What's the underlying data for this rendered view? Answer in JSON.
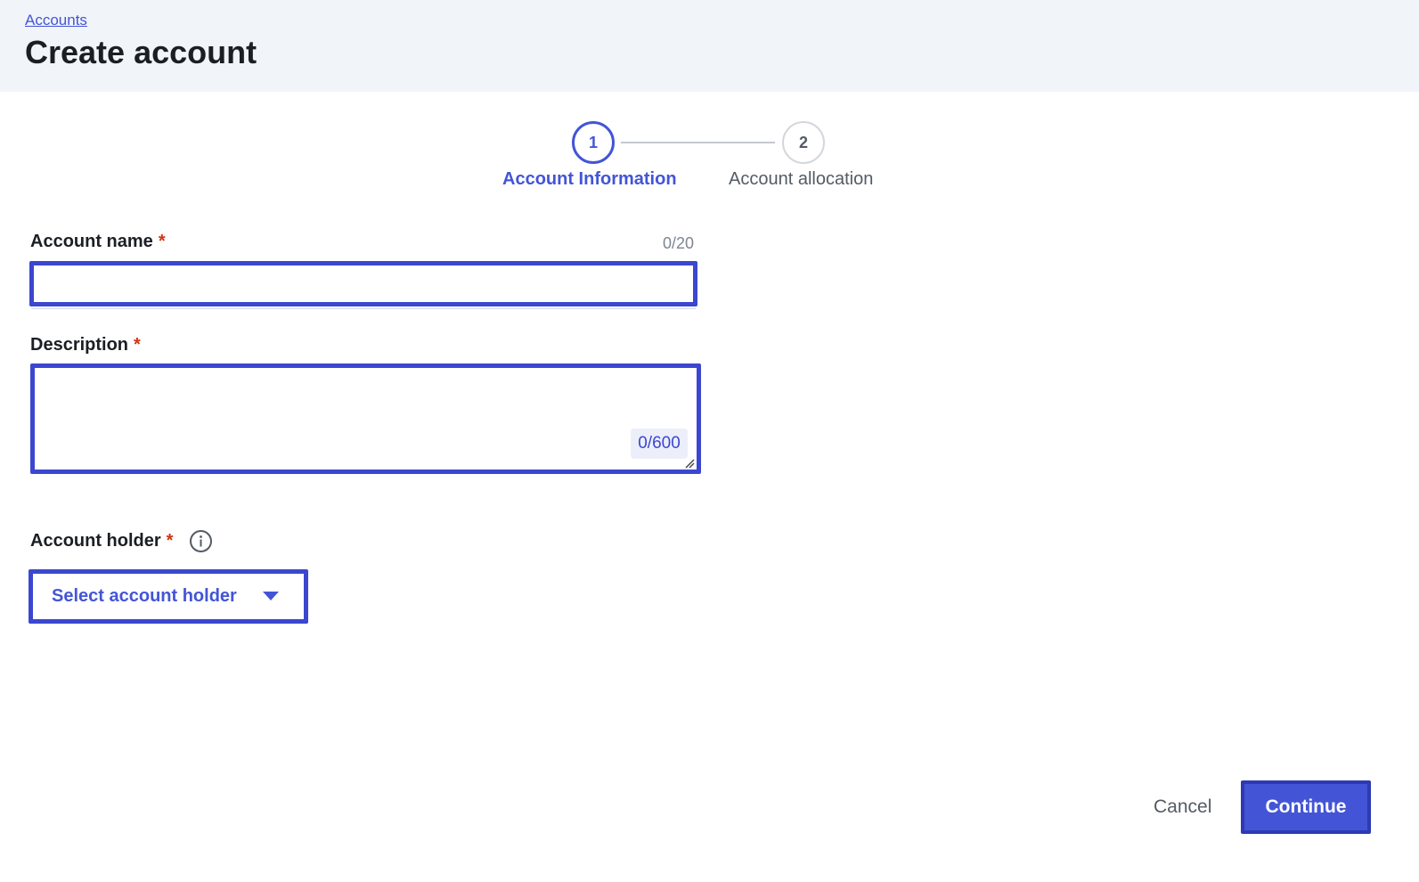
{
  "header": {
    "breadcrumb": "Accounts",
    "title": "Create account"
  },
  "stepper": {
    "steps": [
      {
        "number": "1",
        "label": "Account Information",
        "state": "active"
      },
      {
        "number": "2",
        "label": "Account allocation",
        "state": "inactive"
      }
    ]
  },
  "form": {
    "account_name": {
      "label": "Account name",
      "required_mark": "*",
      "value": "",
      "counter": "0/20"
    },
    "description": {
      "label": "Description",
      "required_mark": "*",
      "value": "",
      "counter": "0/600"
    },
    "account_holder": {
      "label": "Account holder",
      "required_mark": "*",
      "info_icon": "info-icon",
      "select_label": "Select account holder"
    }
  },
  "footer": {
    "cancel_label": "Cancel",
    "continue_label": "Continue"
  },
  "colors": {
    "accent": "#4355d6",
    "focus_border": "#3b47cf",
    "required": "#d13212",
    "header_bg": "#f1f4f8"
  }
}
